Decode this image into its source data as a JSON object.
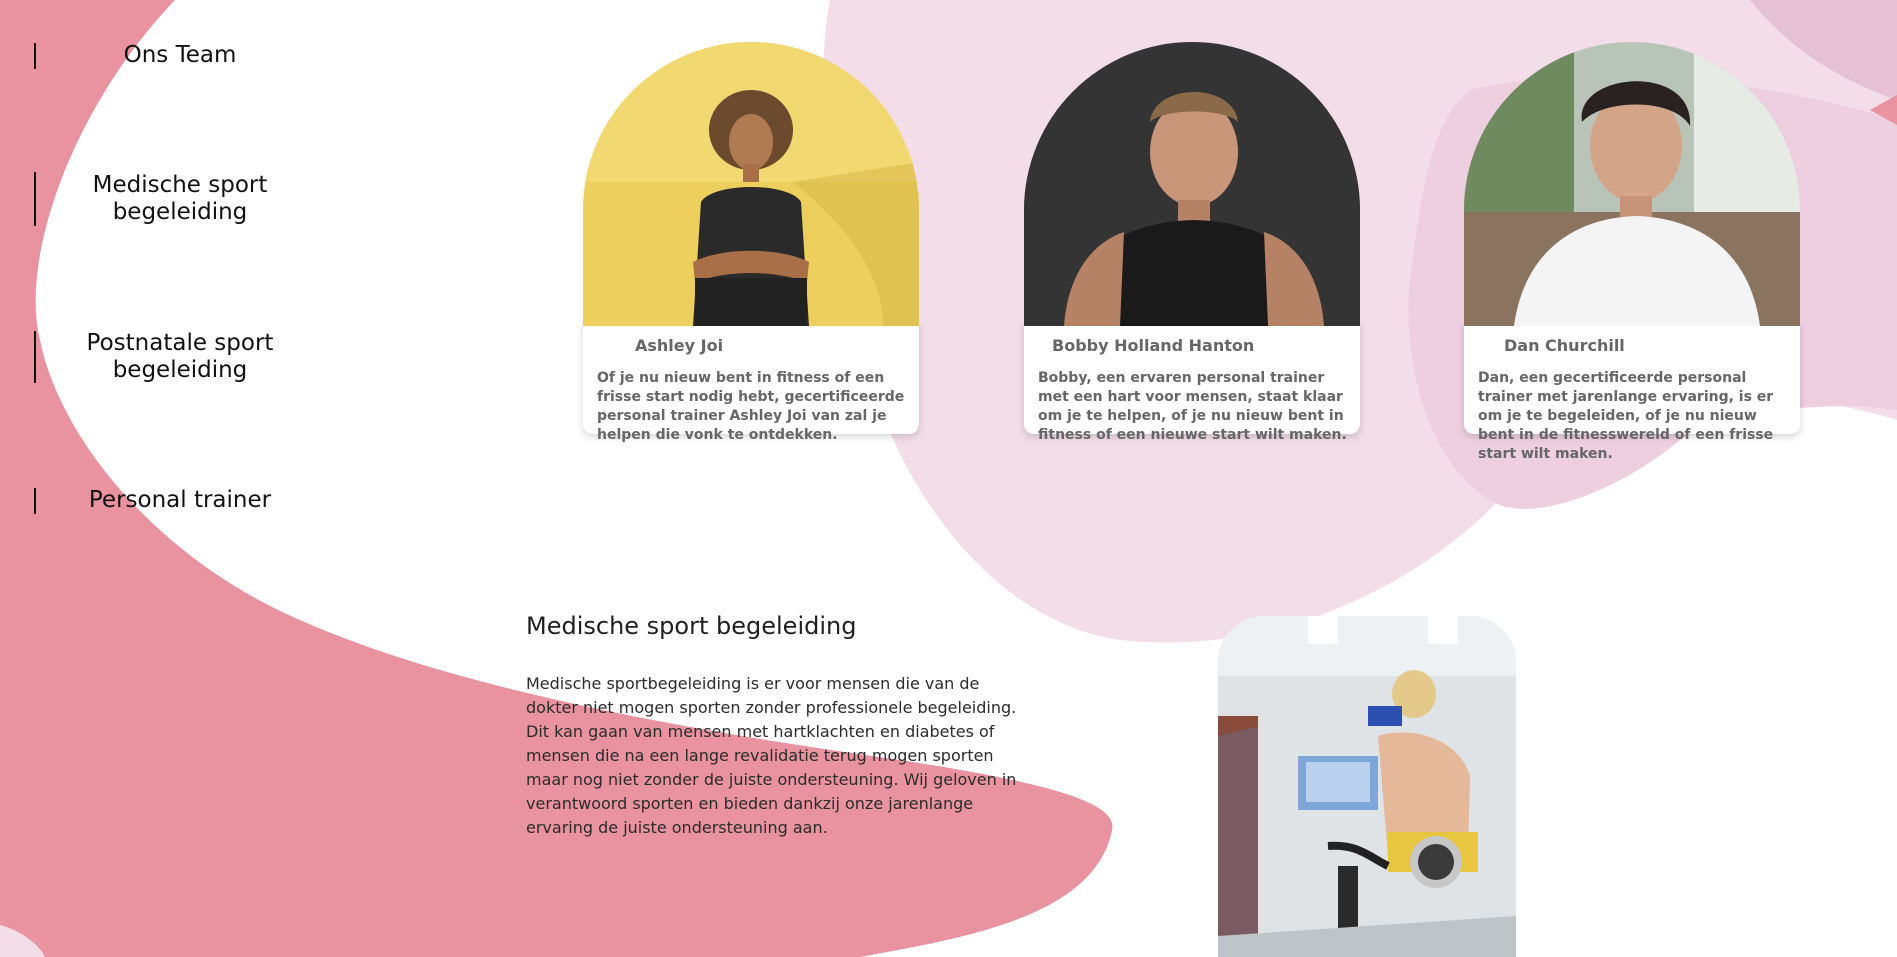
{
  "nav": {
    "items": [
      {
        "label": "Ons Team"
      },
      {
        "label": "Medische sport begeleiding"
      },
      {
        "label": "Postnatale sport begeleiding"
      },
      {
        "label": "Personal trainer"
      }
    ]
  },
  "team": [
    {
      "name": "Ashley Joi",
      "bio": "Of je nu nieuw bent in fitness of een frisse start nodig hebt, gecertificeerde personal trainer Ashley Joi van zal je helpen die vonk te ontdekken."
    },
    {
      "name": "Bobby Holland Hanton",
      "bio": "Bobby, een ervaren personal trainer met een hart voor mensen, staat klaar om je te helpen, of je nu nieuw bent in fitness of een nieuwe start wilt maken."
    },
    {
      "name": "Dan Churchill",
      "bio": "Dan, een gecertificeerde personal trainer met jarenlange ervaring, is er om je te begeleiden, of je nu nieuw bent in de fitnesswereld of een frisse start wilt maken."
    }
  ],
  "section": {
    "title": "Medische sport begeleiding",
    "body": "Medische sportbegeleiding is er voor mensen die van de dokter niet mogen sporten zonder professionele begeleiding. Dit kan gaan van mensen met hartklachten en diabetes of mensen die na een lange revalidatie terug mogen sporten maar nog niet zonder de juiste ondersteuning. Wij geloven in verantwoord sporten en bieden dankzij onze jarenlange ervaring de juiste ondersteuning aan."
  },
  "colors": {
    "blob_pink": "#e8939f",
    "blob_light": "#f2dde8",
    "blob_mid": "#eecfe0"
  }
}
